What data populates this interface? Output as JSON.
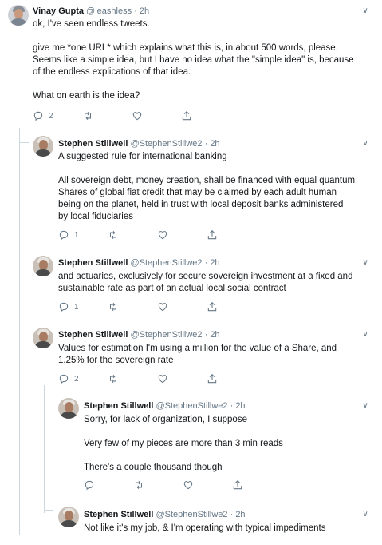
{
  "tweets": [
    {
      "name": "Vinay Gupta",
      "handle": "@leashless",
      "time": "· 2h",
      "lines": [
        "ok, I've seen endless tweets.",
        "",
        "give me *one URL* which explains what this is, in about 500 words, please.",
        "Seems like a simple idea, but I have no idea what the \"simple idea\" is, because",
        "of the endless explications of that idea.",
        "",
        "What on earth is the idea?"
      ],
      "reply_count": "2",
      "retweet_count": "",
      "like_count": ""
    },
    {
      "name": "Stephen Stillwell",
      "handle": "@StephenStillwe2",
      "time": "· 2h",
      "lines": [
        "A suggested rule for international banking",
        "",
        "All sovereign debt, money creation, shall be financed with equal quantum",
        "Shares of global fiat credit that may be claimed by each adult human",
        "being on the planet, held in trust with local deposit banks administered",
        "by local fiduciaries"
      ],
      "reply_count": "1",
      "retweet_count": "",
      "like_count": ""
    },
    {
      "name": "Stephen Stillwell",
      "handle": "@StephenStillwe2",
      "time": "· 2h",
      "lines": [
        "and actuaries, exclusively for secure sovereign investment at a fixed and",
        "sustainable rate as part of an actual local social contract"
      ],
      "reply_count": "1",
      "retweet_count": "",
      "like_count": ""
    },
    {
      "name": "Stephen Stillwell",
      "handle": "@StephenStillwe2",
      "time": "· 2h",
      "lines": [
        "Values for estimation I'm using a million for the value of a Share, and",
        "1.25% for the sovereign rate"
      ],
      "reply_count": "2",
      "retweet_count": "",
      "like_count": ""
    },
    {
      "name": "Stephen Stillwell",
      "handle": "@StephenStillwe2",
      "time": "· 2h",
      "lines": [
        "Sorry, for lack of organization, I suppose",
        "",
        "Very few of my pieces are more than 3 min reads",
        "",
        "There's a couple thousand though"
      ],
      "reply_count": "",
      "retweet_count": "",
      "like_count": ""
    },
    {
      "name": "Stephen Stillwell",
      "handle": "@StephenStillwe2",
      "time": "· 2h",
      "lines": [
        "Not like it's my job, & I'm operating with typical impediments"
      ],
      "reply_count": "",
      "retweet_count": "",
      "like_count": ""
    }
  ],
  "icons": {
    "reply": "reply-icon",
    "retweet": "retweet-icon",
    "like": "like-icon",
    "share": "share-icon",
    "menu": "chevron-down-icon"
  },
  "colors": {
    "text": "#14171a",
    "muted": "#657786",
    "thread_line": "#ccd6dd"
  }
}
